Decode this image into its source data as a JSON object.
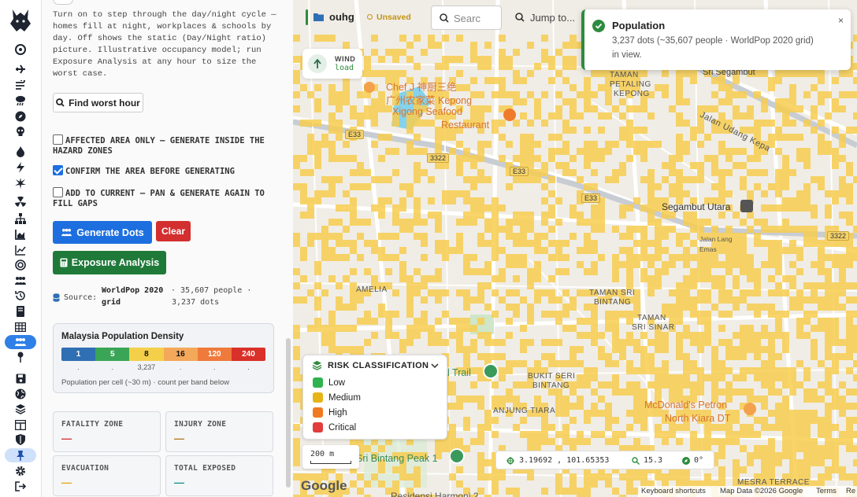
{
  "panel": {
    "description": "Turn on to step through the day/night cycle — homes fill at night, workplaces & schools by day. Off shows the static (Day/Night ratio) picture. Illustrative occupancy model; run Exposure Analysis at any hour to size the worst case.",
    "find_worst_hour": "Find worst hour",
    "checkboxes": [
      {
        "label": "AFFECTED AREA ONLY — GENERATE INSIDE THE HAZARD ZONES",
        "checked": false
      },
      {
        "label": "CONFIRM THE AREA BEFORE GENERATING",
        "checked": true
      },
      {
        "label": "ADD TO CURRENT — PAN & GENERATE AGAIN TO FILL GAPS",
        "checked": false
      }
    ],
    "generate_dots": "Generate Dots",
    "clear": "Clear",
    "exposure_analysis": "Exposure Analysis",
    "source_label": "Source:",
    "source_name_1": "WorldPop 2020",
    "source_name_2": "grid",
    "source_people": "· 35,607 people ·",
    "source_dots": "3,237 dots",
    "density": {
      "title": "Malaysia Population Density",
      "bands": [
        {
          "label": "1",
          "color": "#2f6fb3"
        },
        {
          "label": "5",
          "color": "#3aa556"
        },
        {
          "label": "8",
          "color": "#f4cf4a"
        },
        {
          "label": "16",
          "color": "#f3a85a"
        },
        {
          "label": "120",
          "color": "#ef7a3b"
        },
        {
          "label": "240",
          "color": "#d9302a"
        }
      ],
      "counts": [
        ".",
        ".",
        "3,237",
        ".",
        ".",
        "."
      ],
      "note": "Population per cell (~30 m) · count per band below"
    },
    "stats": [
      {
        "label": "FATALITY ZONE",
        "value": "—",
        "color": "#d32f2f"
      },
      {
        "label": "INJURY ZONE",
        "value": "—",
        "color": "#b07a1c"
      },
      {
        "label": "EVACUATION",
        "value": "—",
        "color": "#e6a817"
      },
      {
        "label": "TOTAL EXPOSED",
        "value": "—",
        "color": "#1a8f8f"
      }
    ]
  },
  "topbar": {
    "project": "ouhg",
    "status": "Unsaved",
    "search_placeholder": "Searc",
    "jump_to": "Jump to..."
  },
  "toast": {
    "title": "Population",
    "body": "3,237 dots (~35,607 people · WorldPop 2020 grid) in view.",
    "close": "×"
  },
  "wind": {
    "label": "WIND",
    "status": "load"
  },
  "map_labels": {
    "poi_chef": "Chef J 神厨三绝",
    "poi_chef_cn": "广州农家菜 Kepong",
    "poi_xigong": "Xigong Seafood",
    "poi_restaurant": "Restaurant",
    "taman_petaling_1": "TAMAN",
    "taman_petaling_2": "PETALING",
    "taman_petaling_3": "KEPONG",
    "segambut": "Segambut Utara",
    "sri_segambut": "Sri Segambut",
    "jalan_ludang": "Jalan Udang Kepa",
    "amelia": "AMELIA",
    "taman_sri_bintang_1": "TAMAN SRI",
    "taman_sri_bintang_2": "BINTANG",
    "taman_sri_sinar_1": "TAMAN",
    "taman_sri_sinar_2": "SRI SINAR",
    "bukit_seri_1": "BUKIT SERI",
    "bukit_seri_2": "BINTANG",
    "anjung_tiara": "ANJUNG TIARA",
    "mcdonalds_1": "McDonald's Petron",
    "mcdonalds_2": "North Kiara DT",
    "sri_bintang_peak": "Sri Bintang Peak 1",
    "residensi": "Residensi Harmoni 2",
    "mesra_terrace": "MESRA TERRACE",
    "trail": "l Trail",
    "jalan_lang_1": "Jalan Lang",
    "jalan_lang_2": "Emas",
    "e33_a": "E33",
    "e33_b": "E33",
    "e33_c": "E33",
    "r3322_a": "3322",
    "r3322_b": "3322"
  },
  "risk": {
    "title": "RISK CLASSIFICATION",
    "levels": [
      {
        "label": "Low",
        "color": "#2fb350"
      },
      {
        "label": "Medium",
        "color": "#e6b417"
      },
      {
        "label": "High",
        "color": "#f07a22"
      },
      {
        "label": "Critical",
        "color": "#e23c3c"
      }
    ]
  },
  "scale": "200 m",
  "coords": {
    "value": "3.19692 , 101.65353",
    "zoom": "15.3",
    "bearing": "0°"
  },
  "footer": {
    "google": "Google",
    "shortcuts": "Keyboard shortcuts",
    "map_data": "Map Data ©2026 Google",
    "terms": "Terms",
    "report": "Re"
  },
  "colors": {
    "accent": "#1d6fe0",
    "population_dot": "#f7cd4f",
    "rail_active": "#2f80e6"
  }
}
